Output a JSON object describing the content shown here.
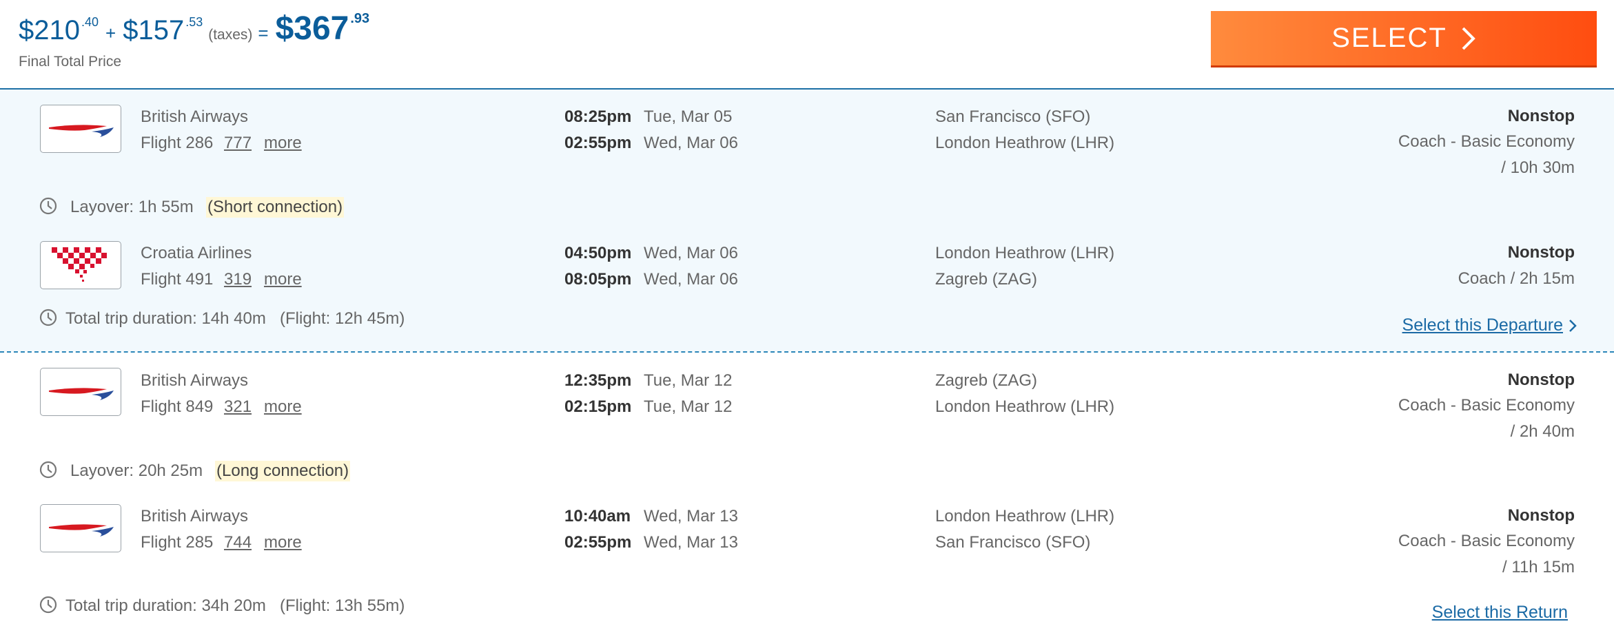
{
  "price": {
    "base_dollars": "$210",
    "base_cents": ".40",
    "plus": "+",
    "taxes_dollars": "$157",
    "taxes_cents": ".53",
    "taxes_label": "(taxes)",
    "equals": "=",
    "total_dollars": "$367",
    "total_cents": ".93",
    "final_label": "Final Total Price"
  },
  "select_button": {
    "label": "SELECT",
    "icon": "chevron-right-icon",
    "gradient": [
      "#ff8b3d",
      "#ff4d10"
    ]
  },
  "colors": {
    "accent": "#0b5d9a",
    "link": "#1b6aa5",
    "panel_bg": "#f2f9fd",
    "badge_bg": "#fff7d6"
  },
  "departure": {
    "segments": [
      {
        "airline": "British Airways",
        "logo": "british-airways-logo",
        "flight": "Flight 286",
        "aircraft": "777",
        "more": "more",
        "dep_time": "08:25pm",
        "dep_date": "Tue, Mar 05",
        "arr_time": "02:55pm",
        "arr_date": "Wed, Mar 06",
        "from": "San Francisco (SFO)",
        "to": "London Heathrow (LHR)",
        "stops": "Nonstop",
        "cabin": "Coach - Basic Economy",
        "duration": "/ 10h 30m"
      },
      {
        "airline": "Croatia Airlines",
        "logo": "croatia-airlines-logo",
        "flight": "Flight 491",
        "aircraft": "319",
        "more": "more",
        "dep_time": "04:50pm",
        "dep_date": "Wed, Mar 06",
        "arr_time": "08:05pm",
        "arr_date": "Wed, Mar 06",
        "from": "London Heathrow (LHR)",
        "to": "Zagreb (ZAG)",
        "stops": "Nonstop",
        "cabin_duration": "Coach / 2h 15m"
      }
    ],
    "layover": {
      "text": "Layover: 1h 55m",
      "badge": "(Short connection)"
    },
    "total": "Total trip duration: 14h 40m",
    "flight_time": "(Flight: 12h 45m)",
    "select_link": "Select this Departure"
  },
  "return": {
    "segments": [
      {
        "airline": "British Airways",
        "logo": "british-airways-logo",
        "flight": "Flight 849",
        "aircraft": "321",
        "more": "more",
        "dep_time": "12:35pm",
        "dep_date": "Tue, Mar 12",
        "arr_time": "02:15pm",
        "arr_date": "Tue, Mar 12",
        "from": "Zagreb (ZAG)",
        "to": "London Heathrow (LHR)",
        "stops": "Nonstop",
        "cabin": "Coach - Basic Economy",
        "duration": "/ 2h 40m"
      },
      {
        "airline": "British Airways",
        "logo": "british-airways-logo",
        "flight": "Flight 285",
        "aircraft": "744",
        "more": "more",
        "dep_time": "10:40am",
        "dep_date": "Wed, Mar 13",
        "arr_time": "02:55pm",
        "arr_date": "Wed, Mar 13",
        "from": "London Heathrow (LHR)",
        "to": "San Francisco (SFO)",
        "stops": "Nonstop",
        "cabin": "Coach - Basic Economy",
        "duration": "/ 11h 15m"
      }
    ],
    "layover": {
      "text": "Layover: 20h 25m",
      "badge": "(Long connection)"
    },
    "total": "Total trip duration: 34h 20m",
    "flight_time": "(Flight: 13h 55m)",
    "select_link": "Select this Return"
  }
}
